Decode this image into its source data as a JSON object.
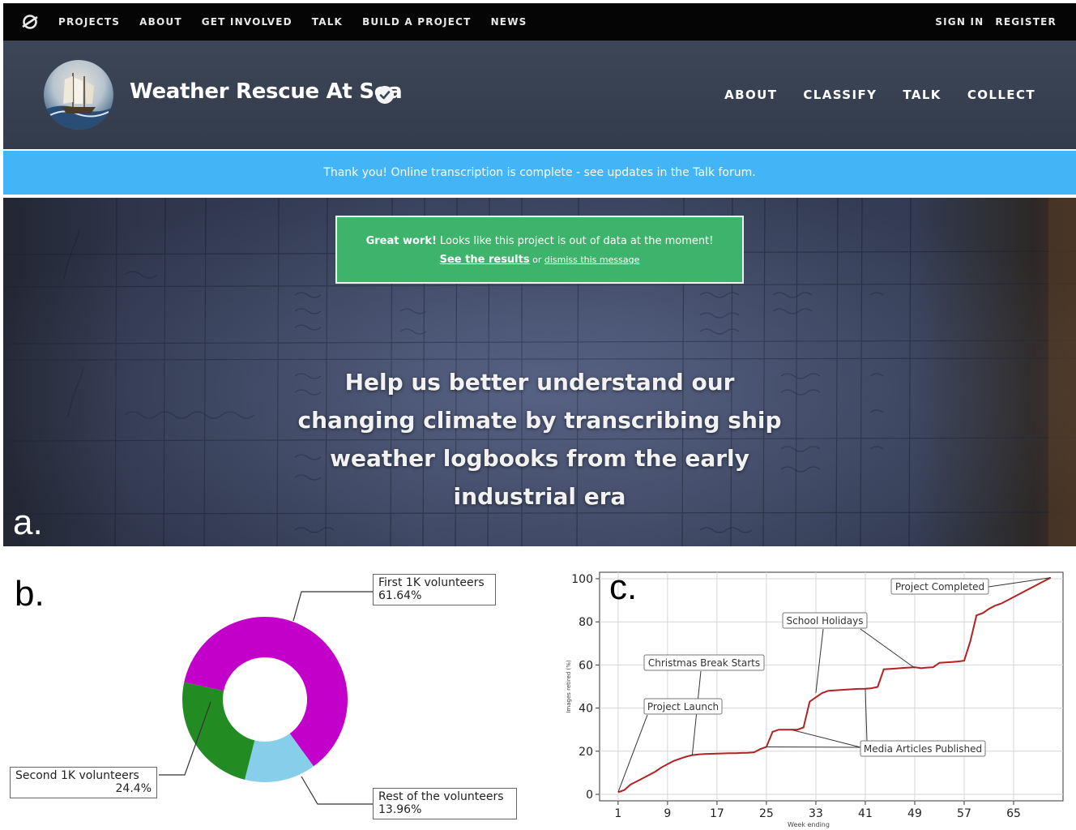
{
  "site_nav": {
    "links": [
      "PROJECTS",
      "ABOUT",
      "GET INVOLVED",
      "TALK",
      "BUILD A PROJECT",
      "NEWS"
    ],
    "auth": [
      "SIGN IN",
      "REGISTER"
    ]
  },
  "project": {
    "title": "Weather Rescue At Sea",
    "links": [
      "ABOUT",
      "CLASSIFY",
      "TALK",
      "COLLECT"
    ]
  },
  "banner": {
    "text": "Thank you! Online transcription is complete - see updates in the Talk forum."
  },
  "notice": {
    "bold": "Great work!",
    "text": " Looks like this project is out of data at the moment!",
    "results_link": "See the results",
    "or": " or ",
    "dismiss_link": "dismiss this message"
  },
  "hero": {
    "tagline": "Help us better understand our changing climate by transcribing ship weather logbooks from the early industrial era"
  },
  "labels": {
    "a": "a.",
    "b": "b.",
    "c": "c."
  },
  "colors": {
    "nav_bg": "#050505",
    "banner": "#43b4f5",
    "notice": "#3db36b",
    "magenta": "#c300c9",
    "green": "#228b22",
    "skyblue": "#87ceeb",
    "line": "#b22222"
  },
  "chart_data": [
    {
      "type": "pie",
      "donut": true,
      "categories": [
        "First 1K volunteers",
        "Second 1K volunteers",
        "Rest of the volunteers"
      ],
      "values": [
        61.64,
        24.4,
        13.96
      ],
      "value_labels": [
        "61.64%",
        "24.4%",
        "13.96%"
      ],
      "colors": [
        "#c300c9",
        "#228b22",
        "#87ceeb"
      ]
    },
    {
      "type": "line",
      "xlabel": "Week ending",
      "ylabel": "Images retired (%)",
      "xticks": [
        1,
        9,
        17,
        25,
        33,
        41,
        49,
        57,
        65
      ],
      "yticks": [
        0,
        20,
        40,
        60,
        80,
        100
      ],
      "xlim": [
        -2,
        73
      ],
      "ylim": [
        -3,
        103
      ],
      "grid": true,
      "x": [
        1,
        2,
        3,
        4,
        5,
        6,
        7,
        8,
        9,
        10,
        11,
        12,
        13,
        14,
        15,
        16,
        17,
        18,
        19,
        20,
        21,
        22,
        23,
        24,
        25,
        26,
        27,
        28,
        29,
        30,
        31,
        32,
        33,
        34,
        35,
        36,
        37,
        38,
        39,
        40,
        41,
        42,
        43,
        44,
        45,
        46,
        47,
        48,
        49,
        50,
        51,
        52,
        53,
        54,
        55,
        56,
        57,
        58,
        59,
        60,
        61,
        62,
        63,
        64,
        65,
        66,
        67,
        68,
        69,
        70,
        71
      ],
      "y": [
        1,
        2,
        4.5,
        6,
        7.5,
        9,
        10.5,
        12.5,
        14,
        15.5,
        16.5,
        17.5,
        18.2,
        18.5,
        18.7,
        18.8,
        18.9,
        19,
        19.1,
        19.1,
        19.2,
        19.3,
        19.5,
        21,
        22,
        29,
        30,
        30,
        30,
        30,
        31,
        43,
        45,
        47,
        48,
        48.2,
        48.4,
        48.6,
        48.8,
        48.9,
        49,
        49.2,
        49.8,
        58,
        58.2,
        58.4,
        58.6,
        58.8,
        59,
        58.5,
        58.8,
        59,
        61,
        61.2,
        61.4,
        61.6,
        62,
        71,
        83,
        84,
        86,
        87.5,
        88.5,
        90,
        91.5,
        93,
        94.5,
        96,
        97.5,
        99,
        100.5
      ],
      "annotations": [
        {
          "text": "Project Completed",
          "x": 71,
          "y": 100.5
        },
        {
          "text": "School Holidays",
          "x": 33,
          "y": 47
        },
        {
          "text": "Christmas Break Starts",
          "x": 13,
          "y": 18.2
        },
        {
          "text": "Project Launch",
          "x": 1,
          "y": 1
        },
        {
          "text": "Media Articles Published",
          "x": 44,
          "y": 58
        }
      ]
    }
  ]
}
